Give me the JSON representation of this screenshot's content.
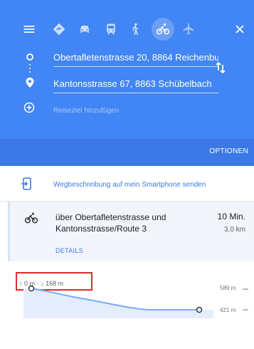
{
  "header": {
    "background": "#4285f4",
    "modes": [
      {
        "name": "menu-icon",
        "active": false
      },
      {
        "name": "best-mode-icon",
        "active": false
      },
      {
        "name": "car-icon",
        "active": false
      },
      {
        "name": "transit-icon",
        "active": false
      },
      {
        "name": "walk-icon",
        "active": false
      },
      {
        "name": "bicycle-icon",
        "active": true
      },
      {
        "name": "flight-icon",
        "active": false
      },
      {
        "name": "close-icon",
        "active": false
      }
    ],
    "origin": "Obertafletenstrasse 20, 8864 Reichenbu",
    "destination": "Kantonsstrasse 67, 8863 Schübelbach",
    "add_destination": "Reiseziel hinzufügen",
    "options": "OPTIONEN"
  },
  "send": {
    "label": "Wegbeschreibung auf mein Smartphone senden",
    "color": "#3c79e6"
  },
  "route": {
    "title": "über Obertafletenstrasse und Kantonsstrasse/Route 3",
    "time": "10 Min.",
    "distance": "3,0 km",
    "details": "DETAILS"
  },
  "elevation": {
    "summary_up": "0 m",
    "summary_sep": "·",
    "summary_down": "168 m",
    "max_label": "589 m",
    "min_label": "421 m",
    "profile_color": "#7baaf7"
  }
}
